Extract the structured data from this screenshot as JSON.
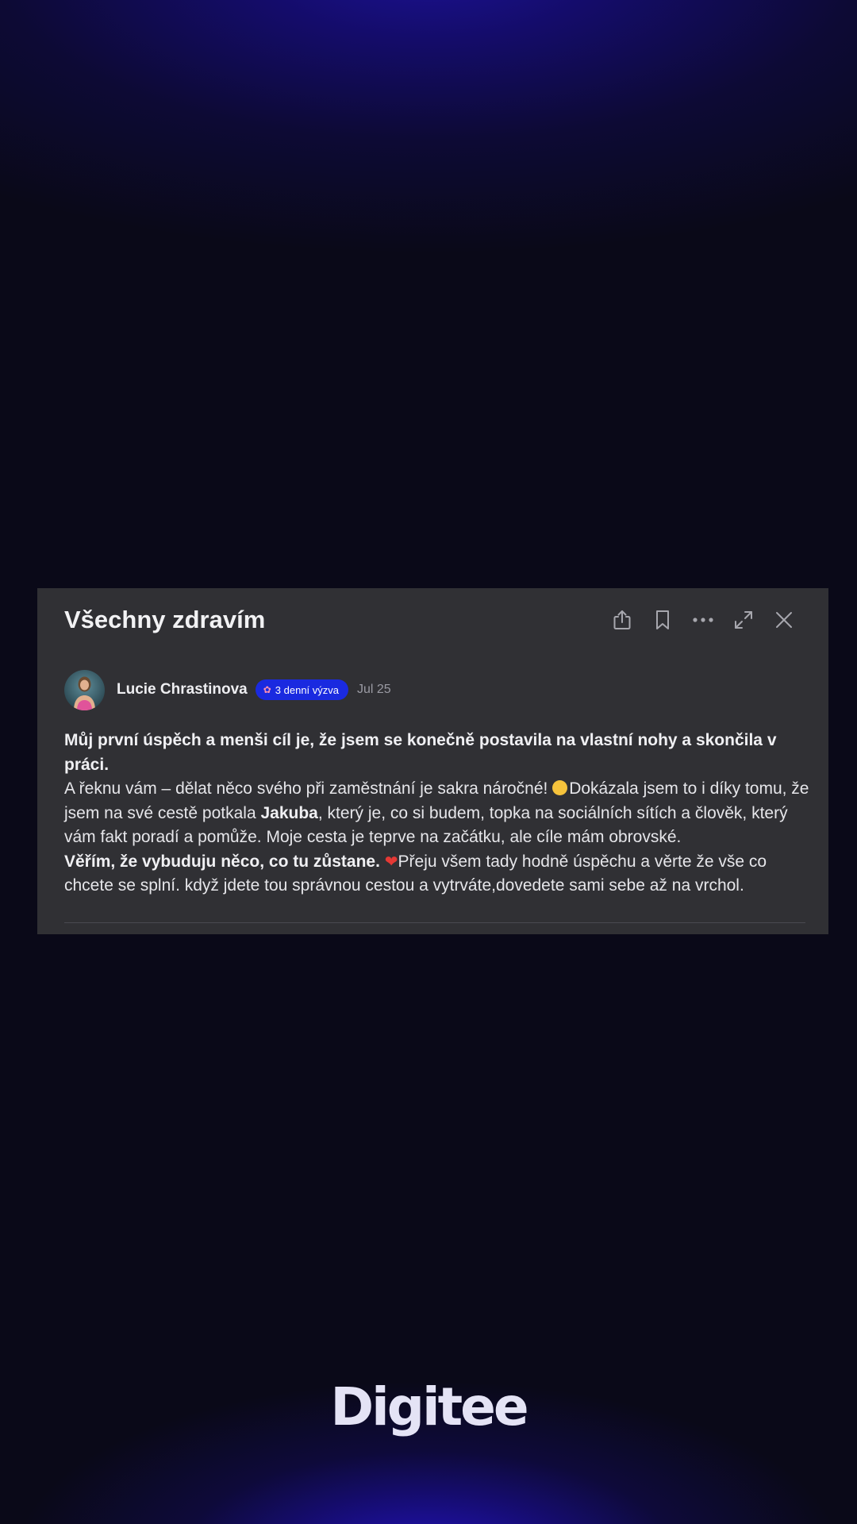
{
  "post": {
    "title": "Všechny zdravím",
    "author": {
      "name": "Lucie Chrastinova",
      "badge": {
        "icon": "brain-icon",
        "label": "3 denní výzva",
        "color": "#1a2ae0"
      },
      "date": "Jul 25"
    },
    "body": {
      "p1_bold": "Můj první úspěch a menši cíl je, že jsem se konečně postavila na vlastní nohy a skončila v práci.",
      "p2_a": "A řeknu vám – dělat něco svého při zaměstnání je sakra náročné! ",
      "p2_b": "Dokázala jsem to i díky tomu, že jsem na své cestě potkala ",
      "p2_bold": "Jakuba",
      "p2_c": ", který je, co si budem, topka na sociálních sítích a člověk, který vám fakt poradí a pomůže. Moje cesta je teprve na začátku, ale cíle mám obrovské.",
      "p3_bold": "Věřím, že vybuduju něco, co tu zůstane. ",
      "p3_text": "Přeju všem tady hodně úspěchu a věrte že vše co chcete se splní. když jdete tou správnou cestou  a vytrváte,dovedete sami sebe až na vrchol."
    },
    "actions": [
      {
        "icon": "share-icon"
      },
      {
        "icon": "bookmark-icon"
      },
      {
        "icon": "more-icon"
      },
      {
        "icon": "expand-icon"
      },
      {
        "icon": "close-icon"
      }
    ]
  },
  "brand": {
    "logo_text": "Digitee"
  },
  "colors": {
    "background": "#0a0918",
    "card": "#303034",
    "accent": "#1a2ae0"
  }
}
